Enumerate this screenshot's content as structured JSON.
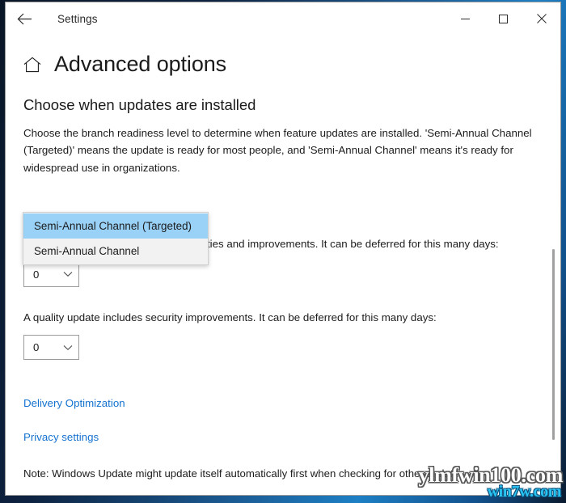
{
  "window": {
    "app_title": "Settings",
    "back_icon": "back-arrow-icon",
    "minimize_label": "─",
    "maximize_label": "□",
    "close_label": "✕"
  },
  "page": {
    "home_icon": "home-icon",
    "title": "Advanced options",
    "section_heading": "Choose when updates are installed",
    "intro_text": "Choose the branch readiness level to determine when feature updates are installed. 'Semi-Annual Channel (Targeted)' means the update is ready for most people, and 'Semi-Annual Channel' means it's ready for widespread use in organizations."
  },
  "branch_dropdown": {
    "expanded": true,
    "selected": "Semi-Annual Channel (Targeted)",
    "options": [
      "Semi-Annual Channel (Targeted)",
      "Semi-Annual Channel"
    ]
  },
  "feature_update": {
    "description": "A feature update includes new capabilities and improvements. It can be deferred for this many days:",
    "value": "0",
    "chevron_icon": "chevron-down-icon"
  },
  "quality_update": {
    "description": "A quality update includes security improvements. It can be deferred for this many days:",
    "value": "0",
    "chevron_icon": "chevron-down-icon"
  },
  "links": {
    "delivery_optimization": "Delivery Optimization",
    "privacy_settings": "Privacy settings"
  },
  "note": {
    "text": "Note: Windows Update might update itself automatically first when checking for other updates."
  },
  "watermarks": {
    "primary": "ylmfwin100.com",
    "secondary": "win7w.com"
  },
  "colors": {
    "link": "#1572cf",
    "dropdown_highlight": "#99d1f7",
    "window_bg": "#ffffff",
    "watermark_secondary": "#29c3f2"
  }
}
